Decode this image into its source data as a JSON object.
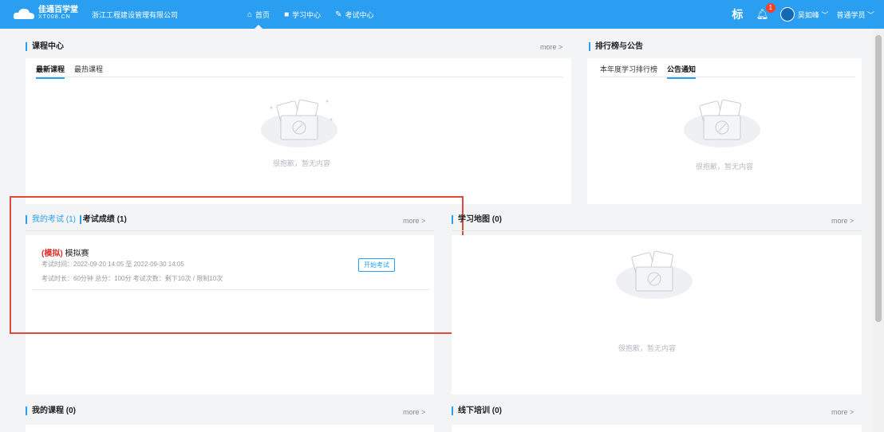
{
  "topbar": {
    "logo_line1": "佳通百学堂",
    "logo_line2": "XT008.CN",
    "company": "浙江工程建设管理有限公司",
    "nav": [
      {
        "icon": "home-icon",
        "label": "首页"
      },
      {
        "icon": "book-icon",
        "label": "学习中心"
      },
      {
        "icon": "pencil-icon",
        "label": "考试中心"
      }
    ],
    "biao": "标",
    "notify_count": "1",
    "user_name": "吴如峰",
    "role": "普通学员"
  },
  "course_center": {
    "title": "课程中心",
    "more": "more >",
    "tabs": [
      "最新课程",
      "最热课程"
    ],
    "empty": "很抱歉，暂无内容"
  },
  "rank": {
    "title": "排行榜与公告",
    "tabs": [
      "本年度学习排行榜",
      "公告通知"
    ],
    "empty": "很抱歉，暂无内容"
  },
  "exam": {
    "title_prefix": "我的考试",
    "count": "(1)",
    "title2": "考试成绩 (1)",
    "more": "more >",
    "item": {
      "tag": "(模拟)",
      "name": "模拟赛",
      "time": "考试时间：2022-09-20 14:05 至 2022-09-30 14:05",
      "meta": "考试时长：60分钟    总分：100分    考试次数：剩下10次 / 限制10次",
      "button": "开始考试"
    }
  },
  "study_map": {
    "title": "学习地图 (0)",
    "more": "more >",
    "empty": "很抱歉，暂无内容"
  },
  "my_course": {
    "title": "我的课程 (0)",
    "more": "more >"
  },
  "offline": {
    "title": "线下培训 (0)",
    "more": "more >"
  }
}
